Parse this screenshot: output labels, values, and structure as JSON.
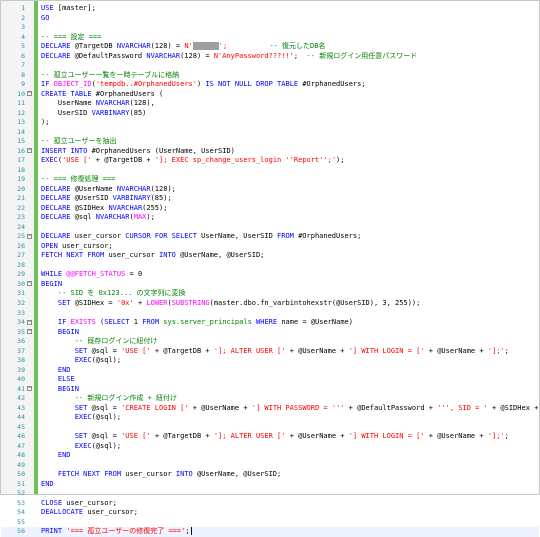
{
  "lines": [
    {
      "n": "1",
      "fold": "",
      "tokens": [
        {
          "c": "kw",
          "t": "USE "
        },
        {
          "c": "",
          "t": "[master];"
        }
      ]
    },
    {
      "n": "2",
      "fold": "",
      "tokens": [
        {
          "c": "kw",
          "t": "GO"
        }
      ]
    },
    {
      "n": "3",
      "fold": "",
      "tokens": []
    },
    {
      "n": "4",
      "fold": "",
      "tokens": [
        {
          "c": "cmt",
          "t": "-- === 設定 ==="
        }
      ]
    },
    {
      "n": "5",
      "fold": "",
      "tokens": [
        {
          "c": "kw",
          "t": "DECLARE "
        },
        {
          "c": "",
          "t": "@TargetDB "
        },
        {
          "c": "kw",
          "t": "NVARCHAR"
        },
        {
          "c": "",
          "t": "(128) = "
        },
        {
          "c": "str",
          "t": "N'"
        },
        {
          "c": "redact",
          "t": ""
        },
        {
          "c": "str",
          "t": "';"
        },
        {
          "c": "",
          "t": "          "
        },
        {
          "c": "cmt",
          "t": "-- 復元したDB名"
        }
      ]
    },
    {
      "n": "6",
      "fold": "",
      "tokens": [
        {
          "c": "kw",
          "t": "DECLARE "
        },
        {
          "c": "",
          "t": "@DefaultPassword "
        },
        {
          "c": "kw",
          "t": "NVARCHAR"
        },
        {
          "c": "",
          "t": "(128) = "
        },
        {
          "c": "str",
          "t": "N'AnyPassword???!!'"
        },
        {
          "c": "",
          "t": ";  "
        },
        {
          "c": "cmt",
          "t": "-- 新規ログイン用任意パスワード"
        }
      ]
    },
    {
      "n": "7",
      "fold": "",
      "tokens": []
    },
    {
      "n": "8",
      "fold": "",
      "tokens": [
        {
          "c": "cmt",
          "t": "-- 孤立ユーザー一覧を一時テーブルに格納"
        }
      ]
    },
    {
      "n": "9",
      "fold": "",
      "tokens": [
        {
          "c": "kw",
          "t": "IF "
        },
        {
          "c": "fn",
          "t": "OBJECT_ID"
        },
        {
          "c": "",
          "t": "("
        },
        {
          "c": "str",
          "t": "'tempdb..#OrphanedUsers'"
        },
        {
          "c": "",
          "t": ") "
        },
        {
          "c": "kw",
          "t": "IS NOT NULL DROP TABLE "
        },
        {
          "c": "",
          "t": "#OrphanedUsers;"
        }
      ]
    },
    {
      "n": "10",
      "fold": "−",
      "tokens": [
        {
          "c": "kw",
          "t": "CREATE TABLE "
        },
        {
          "c": "",
          "t": "#OrphanedUsers ("
        }
      ]
    },
    {
      "n": "11",
      "fold": "",
      "tokens": [
        {
          "c": "",
          "t": "    UserName "
        },
        {
          "c": "kw",
          "t": "NVARCHAR"
        },
        {
          "c": "",
          "t": "(128),"
        }
      ]
    },
    {
      "n": "12",
      "fold": "",
      "tokens": [
        {
          "c": "",
          "t": "    UserSID "
        },
        {
          "c": "kw",
          "t": "VARBINARY"
        },
        {
          "c": "",
          "t": "(85)"
        }
      ]
    },
    {
      "n": "13",
      "fold": "",
      "tokens": [
        {
          "c": "",
          "t": ");"
        }
      ]
    },
    {
      "n": "14",
      "fold": "",
      "tokens": []
    },
    {
      "n": "15",
      "fold": "",
      "tokens": [
        {
          "c": "cmt",
          "t": "-- 孤立ユーザーを抽出"
        }
      ]
    },
    {
      "n": "16",
      "fold": "−",
      "tokens": [
        {
          "c": "kw",
          "t": "INSERT INTO "
        },
        {
          "c": "",
          "t": "#OrphanedUsers (UserName, UserSID)"
        }
      ]
    },
    {
      "n": "17",
      "fold": "",
      "tokens": [
        {
          "c": "kw",
          "t": "EXEC"
        },
        {
          "c": "",
          "t": "("
        },
        {
          "c": "str",
          "t": "'USE ['"
        },
        {
          "c": "",
          "t": " + @TargetDB + "
        },
        {
          "c": "str",
          "t": "']; EXEC sp_change_users_login ''Report'';'"
        },
        {
          "c": "",
          "t": ");"
        }
      ]
    },
    {
      "n": "18",
      "fold": "",
      "tokens": []
    },
    {
      "n": "19",
      "fold": "",
      "tokens": [
        {
          "c": "cmt",
          "t": "-- === 修復処理 ==="
        }
      ]
    },
    {
      "n": "20",
      "fold": "",
      "tokens": [
        {
          "c": "kw",
          "t": "DECLARE "
        },
        {
          "c": "",
          "t": "@UserName "
        },
        {
          "c": "kw",
          "t": "NVARCHAR"
        },
        {
          "c": "",
          "t": "(128);"
        }
      ]
    },
    {
      "n": "21",
      "fold": "",
      "tokens": [
        {
          "c": "kw",
          "t": "DECLARE "
        },
        {
          "c": "",
          "t": "@UserSID "
        },
        {
          "c": "kw",
          "t": "VARBINARY"
        },
        {
          "c": "",
          "t": "(85);"
        }
      ]
    },
    {
      "n": "22",
      "fold": "",
      "tokens": [
        {
          "c": "kw",
          "t": "DECLARE "
        },
        {
          "c": "",
          "t": "@SIDHex "
        },
        {
          "c": "kw",
          "t": "NVARCHAR"
        },
        {
          "c": "",
          "t": "(255);"
        }
      ]
    },
    {
      "n": "23",
      "fold": "",
      "tokens": [
        {
          "c": "kw",
          "t": "DECLARE "
        },
        {
          "c": "",
          "t": "@sql "
        },
        {
          "c": "kw",
          "t": "NVARCHAR"
        },
        {
          "c": "",
          "t": "("
        },
        {
          "c": "fn",
          "t": "MAX"
        },
        {
          "c": "",
          "t": ");"
        }
      ]
    },
    {
      "n": "24",
      "fold": "",
      "tokens": []
    },
    {
      "n": "25",
      "fold": "−",
      "tokens": [
        {
          "c": "kw",
          "t": "DECLARE "
        },
        {
          "c": "",
          "t": "user_cursor "
        },
        {
          "c": "kw",
          "t": "CURSOR FOR SELECT "
        },
        {
          "c": "",
          "t": "UserName, UserSID "
        },
        {
          "c": "kw",
          "t": "FROM "
        },
        {
          "c": "",
          "t": "#OrphanedUsers;"
        }
      ]
    },
    {
      "n": "26",
      "fold": "",
      "tokens": [
        {
          "c": "kw",
          "t": "OPEN "
        },
        {
          "c": "",
          "t": "user_cursor;"
        }
      ]
    },
    {
      "n": "27",
      "fold": "",
      "tokens": [
        {
          "c": "kw",
          "t": "FETCH NEXT FROM "
        },
        {
          "c": "",
          "t": "user_cursor "
        },
        {
          "c": "kw",
          "t": "INTO "
        },
        {
          "c": "",
          "t": "@UserName, @UserSID;"
        }
      ]
    },
    {
      "n": "28",
      "fold": "",
      "tokens": []
    },
    {
      "n": "29",
      "fold": "",
      "tokens": [
        {
          "c": "kw",
          "t": "WHILE "
        },
        {
          "c": "fn",
          "t": "@@FETCH_STATUS"
        },
        {
          "c": "",
          "t": " = 0"
        }
      ]
    },
    {
      "n": "30",
      "fold": "−",
      "tokens": [
        {
          "c": "kw",
          "t": "BEGIN"
        }
      ]
    },
    {
      "n": "31",
      "fold": "",
      "tokens": [
        {
          "c": "cmt",
          "t": "    -- SID を 0x123... の文字列に変換"
        }
      ]
    },
    {
      "n": "32",
      "fold": "",
      "tokens": [
        {
          "c": "",
          "t": "    "
        },
        {
          "c": "kw",
          "t": "SET "
        },
        {
          "c": "",
          "t": "@SIDHex = "
        },
        {
          "c": "str",
          "t": "'0x'"
        },
        {
          "c": "",
          "t": " + "
        },
        {
          "c": "fn",
          "t": "LOWER"
        },
        {
          "c": "",
          "t": "("
        },
        {
          "c": "fn",
          "t": "SUBSTRING"
        },
        {
          "c": "",
          "t": "(master.dbo.fn_varbintohexstr(@UserSID), 3, 255));"
        }
      ]
    },
    {
      "n": "33",
      "fold": "",
      "tokens": []
    },
    {
      "n": "34",
      "fold": "−",
      "tokens": [
        {
          "c": "",
          "t": "    "
        },
        {
          "c": "kw",
          "t": "IF "
        },
        {
          "c": "fn",
          "t": "EXISTS"
        },
        {
          "c": "",
          "t": " ("
        },
        {
          "c": "kw",
          "t": "SELECT "
        },
        {
          "c": "",
          "t": "1 "
        },
        {
          "c": "kw",
          "t": "FROM "
        },
        {
          "c": "sys",
          "t": "sys.server_principals"
        },
        {
          "c": "",
          "t": " "
        },
        {
          "c": "kw",
          "t": "WHERE "
        },
        {
          "c": "",
          "t": "name = @UserName)"
        }
      ]
    },
    {
      "n": "35",
      "fold": "−",
      "tokens": [
        {
          "c": "",
          "t": "    "
        },
        {
          "c": "kw",
          "t": "BEGIN"
        }
      ]
    },
    {
      "n": "36",
      "fold": "",
      "tokens": [
        {
          "c": "cmt",
          "t": "        -- 既存ログインに紐付け"
        }
      ]
    },
    {
      "n": "37",
      "fold": "",
      "tokens": [
        {
          "c": "",
          "t": "        "
        },
        {
          "c": "kw",
          "t": "SET "
        },
        {
          "c": "",
          "t": "@sql = "
        },
        {
          "c": "str",
          "t": "'USE ['"
        },
        {
          "c": "",
          "t": " + @TargetDB + "
        },
        {
          "c": "str",
          "t": "']; ALTER USER ['"
        },
        {
          "c": "",
          "t": " + @UserName + "
        },
        {
          "c": "str",
          "t": "'] WITH LOGIN = ['"
        },
        {
          "c": "",
          "t": " + @UserName + "
        },
        {
          "c": "str",
          "t": "'];'"
        },
        {
          "c": "",
          "t": ";"
        }
      ]
    },
    {
      "n": "38",
      "fold": "",
      "tokens": [
        {
          "c": "",
          "t": "        "
        },
        {
          "c": "kw",
          "t": "EXEC"
        },
        {
          "c": "",
          "t": "(@sql);"
        }
      ]
    },
    {
      "n": "39",
      "fold": "",
      "tokens": [
        {
          "c": "",
          "t": "    "
        },
        {
          "c": "kw",
          "t": "END"
        }
      ]
    },
    {
      "n": "40",
      "fold": "",
      "tokens": [
        {
          "c": "",
          "t": "    "
        },
        {
          "c": "kw",
          "t": "ELSE"
        }
      ]
    },
    {
      "n": "41",
      "fold": "−",
      "tokens": [
        {
          "c": "",
          "t": "    "
        },
        {
          "c": "kw",
          "t": "BEGIN"
        }
      ]
    },
    {
      "n": "42",
      "fold": "",
      "tokens": [
        {
          "c": "cmt",
          "t": "        -- 新規ログイン作成 + 紐付け"
        }
      ]
    },
    {
      "n": "43",
      "fold": "",
      "tokens": [
        {
          "c": "",
          "t": "        "
        },
        {
          "c": "kw",
          "t": "SET "
        },
        {
          "c": "",
          "t": "@sql = "
        },
        {
          "c": "str",
          "t": "'CREATE LOGIN ['"
        },
        {
          "c": "",
          "t": " + @UserName + "
        },
        {
          "c": "str",
          "t": "'] WITH PASSWORD = '''"
        },
        {
          "c": "",
          "t": " + @DefaultPassword + "
        },
        {
          "c": "str",
          "t": "''', SID = '"
        },
        {
          "c": "",
          "t": " + @SIDHex + "
        },
        {
          "c": "str",
          "t": "';'"
        },
        {
          "c": "",
          "t": ";"
        }
      ]
    },
    {
      "n": "44",
      "fold": "",
      "tokens": [
        {
          "c": "",
          "t": "        "
        },
        {
          "c": "kw",
          "t": "EXEC"
        },
        {
          "c": "",
          "t": "(@sql);"
        }
      ]
    },
    {
      "n": "45",
      "fold": "",
      "tokens": []
    },
    {
      "n": "46",
      "fold": "",
      "tokens": [
        {
          "c": "",
          "t": "        "
        },
        {
          "c": "kw",
          "t": "SET "
        },
        {
          "c": "",
          "t": "@sql = "
        },
        {
          "c": "str",
          "t": "'USE ['"
        },
        {
          "c": "",
          "t": " + @TargetDB + "
        },
        {
          "c": "str",
          "t": "']; ALTER USER ['"
        },
        {
          "c": "",
          "t": " + @UserName + "
        },
        {
          "c": "str",
          "t": "'] WITH LOGIN = ['"
        },
        {
          "c": "",
          "t": " + @UserName + "
        },
        {
          "c": "str",
          "t": "'];'"
        },
        {
          "c": "",
          "t": ";"
        }
      ]
    },
    {
      "n": "47",
      "fold": "",
      "tokens": [
        {
          "c": "",
          "t": "        "
        },
        {
          "c": "kw",
          "t": "EXEC"
        },
        {
          "c": "",
          "t": "(@sql);"
        }
      ]
    },
    {
      "n": "48",
      "fold": "",
      "tokens": [
        {
          "c": "",
          "t": "    "
        },
        {
          "c": "kw",
          "t": "END"
        }
      ]
    },
    {
      "n": "49",
      "fold": "",
      "tokens": []
    },
    {
      "n": "50",
      "fold": "",
      "tokens": [
        {
          "c": "",
          "t": "    "
        },
        {
          "c": "kw",
          "t": "FETCH NEXT FROM "
        },
        {
          "c": "",
          "t": "user_cursor "
        },
        {
          "c": "kw",
          "t": "INTO "
        },
        {
          "c": "",
          "t": "@UserName, @UserSID;"
        }
      ]
    },
    {
      "n": "51",
      "fold": "",
      "tokens": [
        {
          "c": "kw",
          "t": "END"
        }
      ]
    },
    {
      "n": "52",
      "fold": "",
      "tokens": []
    },
    {
      "n": "53",
      "fold": "",
      "tokens": [
        {
          "c": "kw",
          "t": "CLOSE "
        },
        {
          "c": "",
          "t": "user_cursor;"
        }
      ]
    },
    {
      "n": "54",
      "fold": "",
      "tokens": [
        {
          "c": "kw",
          "t": "DEALLOCATE "
        },
        {
          "c": "",
          "t": "user_cursor;"
        }
      ]
    },
    {
      "n": "55",
      "fold": "",
      "tokens": []
    },
    {
      "n": "56",
      "fold": "",
      "tokens": [
        {
          "c": "kw",
          "t": "PRINT "
        },
        {
          "c": "str",
          "t": "'=== 孤立ユーザーの修復完了 ==='"
        },
        {
          "c": "",
          "t": ";"
        }
      ]
    }
  ],
  "current_line": "56",
  "colors": {
    "keyword": "#0000ff",
    "function": "#ff00ff",
    "system_object": "#008000",
    "string": "#ff0000",
    "comment": "#008000",
    "line_number": "#2b91af",
    "change_marker": "#6fbf5a"
  }
}
